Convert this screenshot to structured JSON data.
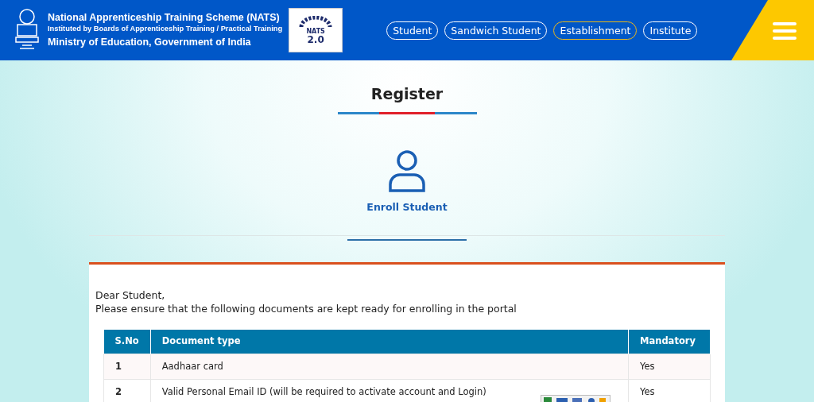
{
  "header": {
    "title": "National Apprenticeship Training Scheme (NATS)",
    "subtitle": "Instituted by Boards of Apprenticeship Training / Practical Training",
    "ministry": "Ministry of Education, Government of India",
    "logo": {
      "line1": "NATS",
      "line2": "2.0"
    }
  },
  "nav": [
    {
      "label": "Student",
      "selected": false
    },
    {
      "label": "Sandwich Student",
      "selected": false
    },
    {
      "label": "Establishment",
      "selected": true
    },
    {
      "label": "Institute",
      "selected": false
    }
  ],
  "page": {
    "title": "Register",
    "enroll_label": "Enroll Student"
  },
  "notice": {
    "greeting": "Dear Student,",
    "message": "Please ensure that the following documents are kept ready for enrolling in the portal"
  },
  "table": {
    "columns": [
      "S.No",
      "Document type",
      "Mandatory"
    ],
    "rows": [
      [
        "1",
        "Aadhaar card",
        "Yes"
      ],
      [
        "2",
        "Valid Personal Email ID (will be required to activate account and Login)",
        "Yes"
      ]
    ]
  }
}
